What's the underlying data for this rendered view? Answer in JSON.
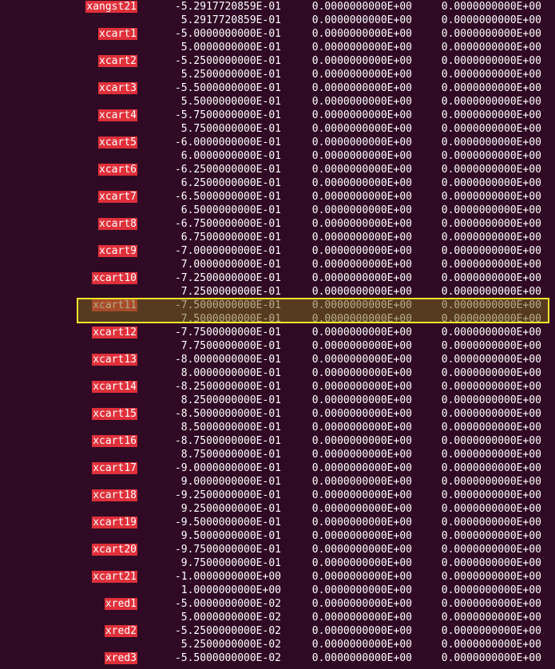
{
  "terminal": {
    "rows": [
      {
        "label": "xangst21",
        "values": [
          "-5.2917720859E-01",
          "0.0000000000E+00",
          "0.0000000000E+00"
        ]
      },
      {
        "label": "",
        "values": [
          "5.2917720859E-01",
          "0.0000000000E+00",
          "0.0000000000E+00"
        ]
      },
      {
        "label": "xcart1",
        "values": [
          "-5.0000000000E-01",
          "0.0000000000E+00",
          "0.0000000000E+00"
        ]
      },
      {
        "label": "",
        "values": [
          "5.0000000000E-01",
          "0.0000000000E+00",
          "0.0000000000E+00"
        ]
      },
      {
        "label": "xcart2",
        "values": [
          "-5.2500000000E-01",
          "0.0000000000E+00",
          "0.0000000000E+00"
        ]
      },
      {
        "label": "",
        "values": [
          "5.2500000000E-01",
          "0.0000000000E+00",
          "0.0000000000E+00"
        ]
      },
      {
        "label": "xcart3",
        "values": [
          "-5.5000000000E-01",
          "0.0000000000E+00",
          "0.0000000000E+00"
        ]
      },
      {
        "label": "",
        "values": [
          "5.5000000000E-01",
          "0.0000000000E+00",
          "0.0000000000E+00"
        ]
      },
      {
        "label": "xcart4",
        "values": [
          "-5.7500000000E-01",
          "0.0000000000E+00",
          "0.0000000000E+00"
        ]
      },
      {
        "label": "",
        "values": [
          "5.7500000000E-01",
          "0.0000000000E+00",
          "0.0000000000E+00"
        ]
      },
      {
        "label": "xcart5",
        "values": [
          "-6.0000000000E-01",
          "0.0000000000E+00",
          "0.0000000000E+00"
        ]
      },
      {
        "label": "",
        "values": [
          "6.0000000000E-01",
          "0.0000000000E+00",
          "0.0000000000E+00"
        ]
      },
      {
        "label": "xcart6",
        "values": [
          "-6.2500000000E-01",
          "0.0000000000E+00",
          "0.0000000000E+00"
        ]
      },
      {
        "label": "",
        "values": [
          "6.2500000000E-01",
          "0.0000000000E+00",
          "0.0000000000E+00"
        ]
      },
      {
        "label": "xcart7",
        "values": [
          "-6.5000000000E-01",
          "0.0000000000E+00",
          "0.0000000000E+00"
        ]
      },
      {
        "label": "",
        "values": [
          "6.5000000000E-01",
          "0.0000000000E+00",
          "0.0000000000E+00"
        ]
      },
      {
        "label": "xcart8",
        "values": [
          "-6.7500000000E-01",
          "0.0000000000E+00",
          "0.0000000000E+00"
        ]
      },
      {
        "label": "",
        "values": [
          "6.7500000000E-01",
          "0.0000000000E+00",
          "0.0000000000E+00"
        ]
      },
      {
        "label": "xcart9",
        "values": [
          "-7.0000000000E-01",
          "0.0000000000E+00",
          "0.0000000000E+00"
        ]
      },
      {
        "label": "",
        "values": [
          "7.0000000000E-01",
          "0.0000000000E+00",
          "0.0000000000E+00"
        ]
      },
      {
        "label": "xcart10",
        "values": [
          "-7.2500000000E-01",
          "0.0000000000E+00",
          "0.0000000000E+00"
        ]
      },
      {
        "label": "",
        "values": [
          "7.2500000000E-01",
          "0.0000000000E+00",
          "0.0000000000E+00"
        ]
      },
      {
        "label": "xcart11",
        "values": [
          "-7.5000000000E-01",
          "0.0000000000E+00",
          "0.0000000000E+00"
        ]
      },
      {
        "label": "",
        "values": [
          "7.5000000000E-01",
          "0.0000000000E+00",
          "0.0000000000E+00"
        ]
      },
      {
        "label": "xcart12",
        "values": [
          "-7.7500000000E-01",
          "0.0000000000E+00",
          "0.0000000000E+00"
        ]
      },
      {
        "label": "",
        "values": [
          "7.7500000000E-01",
          "0.0000000000E+00",
          "0.0000000000E+00"
        ]
      },
      {
        "label": "xcart13",
        "values": [
          "-8.0000000000E-01",
          "0.0000000000E+00",
          "0.0000000000E+00"
        ]
      },
      {
        "label": "",
        "values": [
          "8.0000000000E-01",
          "0.0000000000E+00",
          "0.0000000000E+00"
        ]
      },
      {
        "label": "xcart14",
        "values": [
          "-8.2500000000E-01",
          "0.0000000000E+00",
          "0.0000000000E+00"
        ]
      },
      {
        "label": "",
        "values": [
          "8.2500000000E-01",
          "0.0000000000E+00",
          "0.0000000000E+00"
        ]
      },
      {
        "label": "xcart15",
        "values": [
          "-8.5000000000E-01",
          "0.0000000000E+00",
          "0.0000000000E+00"
        ]
      },
      {
        "label": "",
        "values": [
          "8.5000000000E-01",
          "0.0000000000E+00",
          "0.0000000000E+00"
        ]
      },
      {
        "label": "xcart16",
        "values": [
          "-8.7500000000E-01",
          "0.0000000000E+00",
          "0.0000000000E+00"
        ]
      },
      {
        "label": "",
        "values": [
          "8.7500000000E-01",
          "0.0000000000E+00",
          "0.0000000000E+00"
        ]
      },
      {
        "label": "xcart17",
        "values": [
          "-9.0000000000E-01",
          "0.0000000000E+00",
          "0.0000000000E+00"
        ]
      },
      {
        "label": "",
        "values": [
          "9.0000000000E-01",
          "0.0000000000E+00",
          "0.0000000000E+00"
        ]
      },
      {
        "label": "xcart18",
        "values": [
          "-9.2500000000E-01",
          "0.0000000000E+00",
          "0.0000000000E+00"
        ]
      },
      {
        "label": "",
        "values": [
          "9.2500000000E-01",
          "0.0000000000E+00",
          "0.0000000000E+00"
        ]
      },
      {
        "label": "xcart19",
        "values": [
          "-9.5000000000E-01",
          "0.0000000000E+00",
          "0.0000000000E+00"
        ]
      },
      {
        "label": "",
        "values": [
          "9.5000000000E-01",
          "0.0000000000E+00",
          "0.0000000000E+00"
        ]
      },
      {
        "label": "xcart20",
        "values": [
          "-9.7500000000E-01",
          "0.0000000000E+00",
          "0.0000000000E+00"
        ]
      },
      {
        "label": "",
        "values": [
          "9.7500000000E-01",
          "0.0000000000E+00",
          "0.0000000000E+00"
        ]
      },
      {
        "label": "xcart21",
        "values": [
          "-1.0000000000E+00",
          "0.0000000000E+00",
          "0.0000000000E+00"
        ]
      },
      {
        "label": "",
        "values": [
          "1.0000000000E+00",
          "0.0000000000E+00",
          "0.0000000000E+00"
        ]
      },
      {
        "label": "xred1",
        "values": [
          "-5.0000000000E-02",
          "0.0000000000E+00",
          "0.0000000000E+00"
        ]
      },
      {
        "label": "",
        "values": [
          "5.0000000000E-02",
          "0.0000000000E+00",
          "0.0000000000E+00"
        ]
      },
      {
        "label": "xred2",
        "values": [
          "-5.2500000000E-02",
          "0.0000000000E+00",
          "0.0000000000E+00"
        ]
      },
      {
        "label": "",
        "values": [
          "5.2500000000E-02",
          "0.0000000000E+00",
          "0.0000000000E+00"
        ]
      },
      {
        "label": "xred3",
        "values": [
          "-5.5000000000E-02",
          "0.0000000000E+00",
          "0.0000000000E+00"
        ]
      }
    ],
    "highlighted_row": 22,
    "colors": {
      "background": "#300a24",
      "text": "#ffffff",
      "label_bg": "#e0303a",
      "highlight_border": "#f2e52a"
    }
  }
}
